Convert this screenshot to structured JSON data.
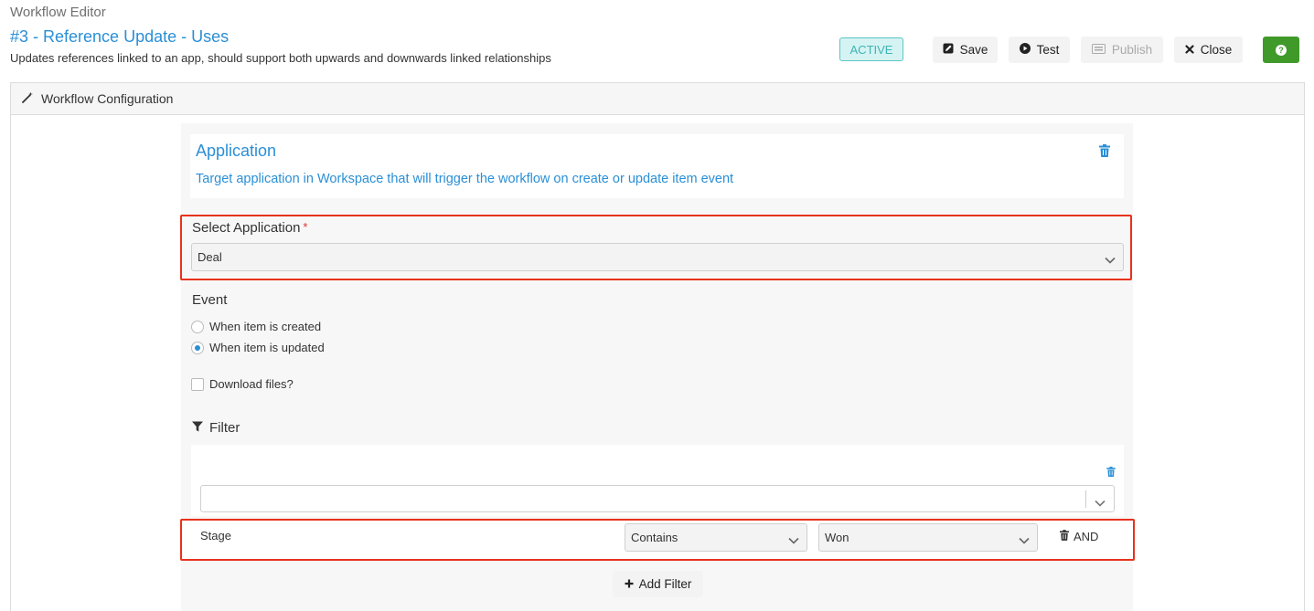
{
  "header": {
    "editor_label": "Workflow Editor",
    "workflow_title": "#3 - Reference Update - Uses",
    "workflow_description": "Updates references linked to an app, should support both upwards and downwards linked relationships",
    "status_badge": "ACTIVE"
  },
  "toolbar": {
    "save_label": "Save",
    "test_label": "Test",
    "publish_label": "Publish",
    "close_label": "Close"
  },
  "panel": {
    "header_label": "Workflow Configuration"
  },
  "application_card": {
    "title": "Application",
    "description": "Target application in Workspace that will trigger the workflow on create or update item event"
  },
  "select_application": {
    "label": "Select Application",
    "required_mark": "*",
    "value": "Deal"
  },
  "event": {
    "label": "Event",
    "options": [
      {
        "label": "When item is created",
        "selected": false
      },
      {
        "label": "When item is updated",
        "selected": true
      }
    ],
    "download_files_label": "Download files?"
  },
  "filter": {
    "label": "Filter",
    "condition": {
      "field": "Stage",
      "operator": "Contains",
      "value": "Won",
      "connector": "AND"
    },
    "add_filter_label": "Add Filter"
  },
  "colors": {
    "accent_blue": "#2a8fd6",
    "active_badge": "#3fb4b4",
    "help_green": "#3f9a2a",
    "highlight_red": "#e8321c"
  }
}
